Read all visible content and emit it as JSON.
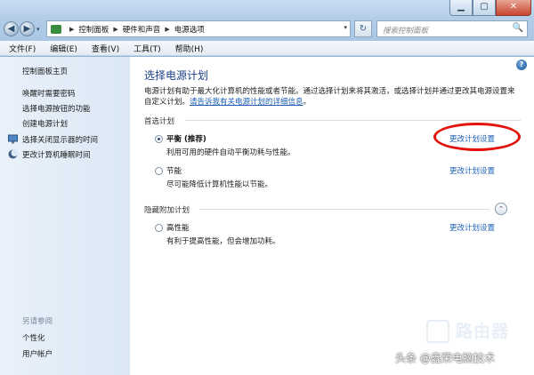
{
  "window": {
    "minimize_glyph": "▁",
    "maximize_glyph": "▢",
    "close_glyph": "✕"
  },
  "nav": {
    "back_glyph": "◀",
    "forward_glyph": "▶",
    "dropdown_glyph": "▾"
  },
  "address": {
    "crumbs": [
      "控制面板",
      "硬件和声音",
      "电源选项"
    ],
    "sep_glyph": "▶",
    "dropdown_glyph": "▾",
    "refresh_glyph": "↻"
  },
  "search": {
    "placeholder": "搜索控制面板",
    "icon_glyph": "🔍"
  },
  "menubar": {
    "items": [
      "文件(F)",
      "编辑(E)",
      "查看(V)",
      "工具(T)",
      "帮助(H)"
    ]
  },
  "sidebar": {
    "home": "控制面板主页",
    "links": [
      "唤醒时需要密码",
      "选择电源按钮的功能",
      "创建电源计划",
      "选择关闭显示器的时间",
      "更改计算机睡眠时间"
    ],
    "see_also": "另请参阅",
    "see_also_links": [
      "个性化",
      "用户帐户"
    ]
  },
  "main": {
    "help_glyph": "?",
    "title": "选择电源计划",
    "description": "电源计划有助于最大化计算机的性能或者节能。通过选择计划来将其激活，或选择计划并通过更改其电源设置来自定义计划。",
    "description_link": "请告诉我有关电源计划的详细信息",
    "preferred_label": "首选计划",
    "hidden_label": "隐藏附加计划",
    "collapse_glyph": "⌃",
    "plans": [
      {
        "name": "平衡 (推荐)",
        "desc": "利用可用的硬件自动平衡功耗与性能。",
        "link": "更改计划设置",
        "selected": true
      },
      {
        "name": "节能",
        "desc": "尽可能降低计算机性能以节能。",
        "link": "更改计划设置",
        "selected": false
      },
      {
        "name": "高性能",
        "desc": "有利于提高性能，但会增加功耗。",
        "link": "更改计划设置",
        "selected": false
      }
    ]
  },
  "watermark": {
    "logo_text": "路由器",
    "credit": "头条 @鑫荣电脑技术"
  },
  "colors": {
    "accent_link": "#1c5fb5",
    "title_blue": "#1a3f8a",
    "annotation_red": "#e3120b"
  }
}
